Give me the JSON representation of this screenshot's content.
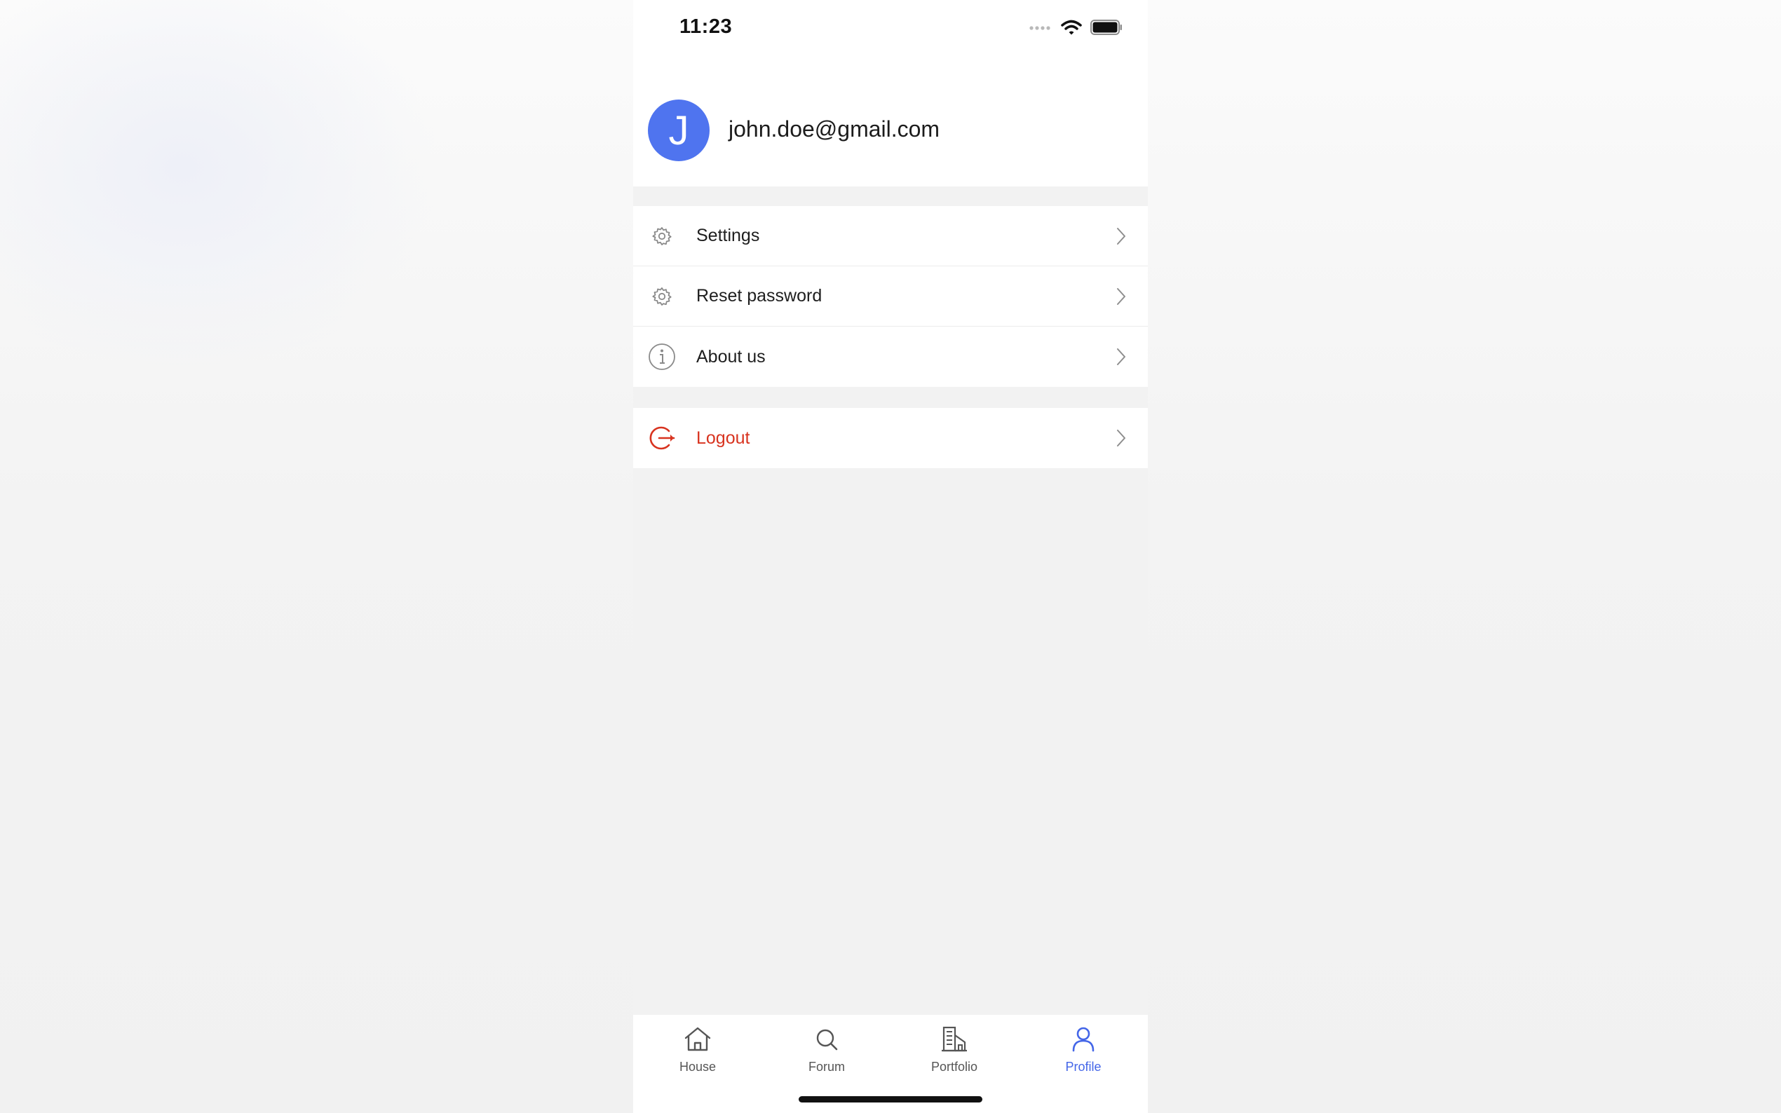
{
  "status_bar": {
    "time": "11:23",
    "icons": [
      "cellular-signal-icon",
      "wifi-icon",
      "battery-icon"
    ]
  },
  "profile": {
    "avatar_letter": "J",
    "avatar_color": "#4f74ef",
    "email": "john.doe@gmail.com"
  },
  "menu": {
    "items": [
      {
        "label": "Settings",
        "icon": "gear-icon"
      },
      {
        "label": "Reset password",
        "icon": "gear-icon"
      },
      {
        "label": "About us",
        "icon": "info-icon"
      }
    ],
    "logout": {
      "label": "Logout",
      "icon": "logout-icon",
      "color": "#d8331f"
    }
  },
  "tab_bar": {
    "active_color": "#4466e8",
    "tabs": [
      {
        "label": "House",
        "icon": "house-icon",
        "active": false
      },
      {
        "label": "Forum",
        "icon": "search-icon",
        "active": false
      },
      {
        "label": "Portfolio",
        "icon": "buildings-icon",
        "active": false
      },
      {
        "label": "Profile",
        "icon": "person-icon",
        "active": true
      }
    ]
  }
}
